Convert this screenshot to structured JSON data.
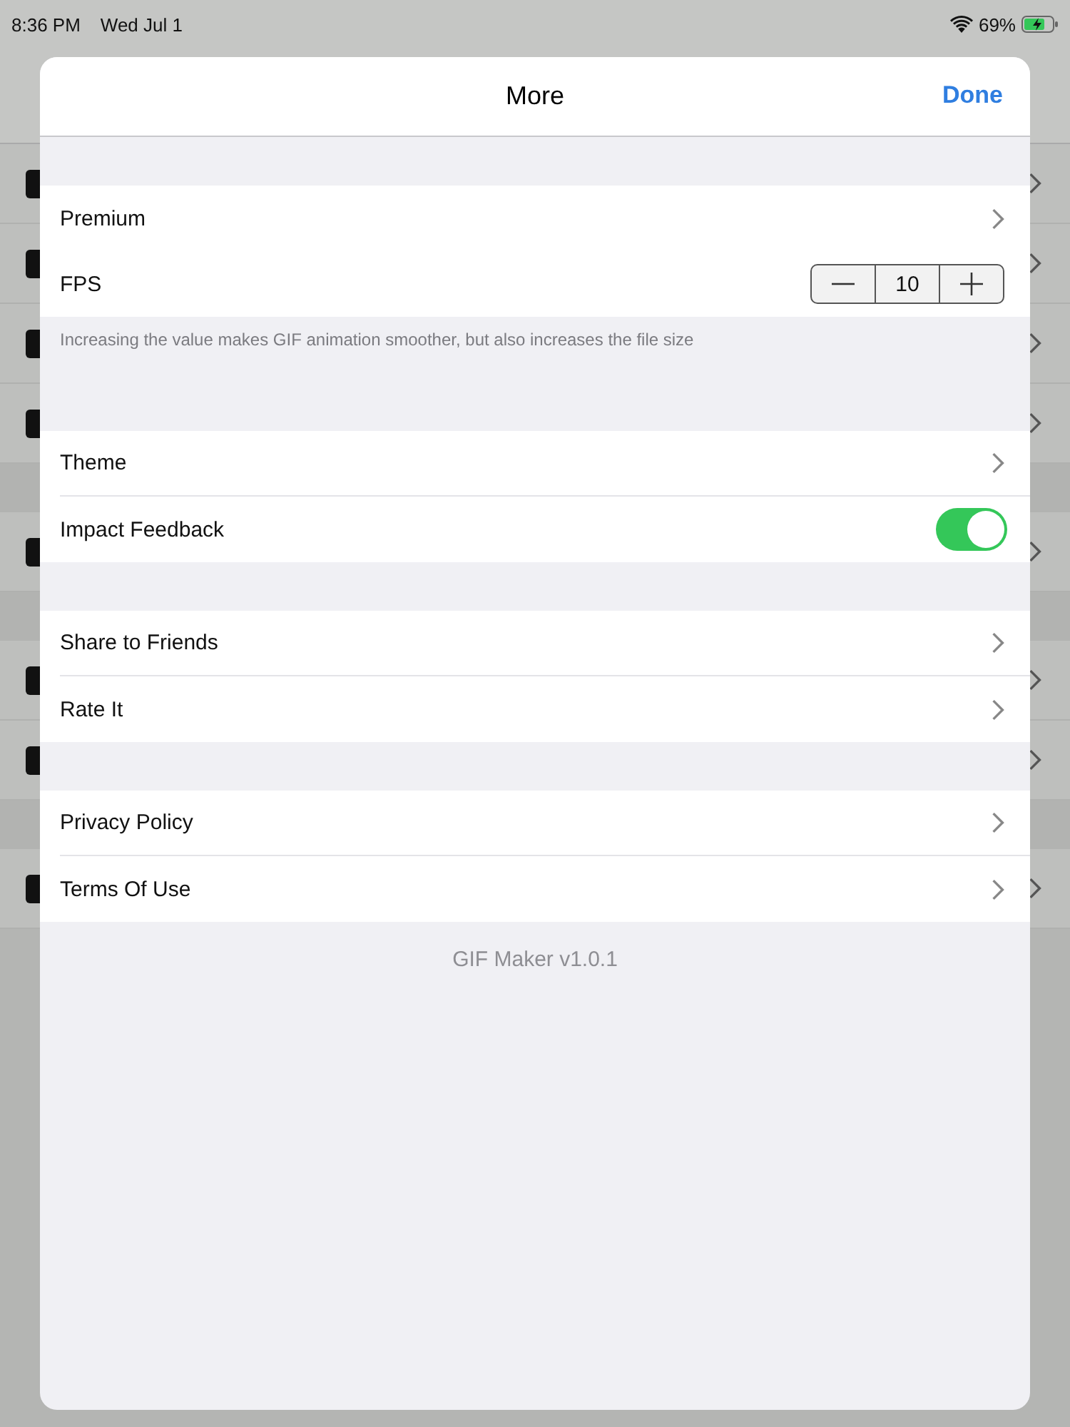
{
  "status_bar": {
    "time": "8:36 PM",
    "date": "Wed Jul 1",
    "battery": "69%"
  },
  "sheet": {
    "title": "More",
    "done": "Done"
  },
  "sections": [
    {
      "rows": [
        {
          "kind": "link",
          "label": "Premium"
        }
      ]
    },
    {
      "rows": [
        {
          "kind": "stepper",
          "label": "FPS",
          "value": "10"
        }
      ],
      "footer": "Increasing the value makes GIF animation smoother, but also increases the file size"
    },
    {
      "rows": [
        {
          "kind": "link",
          "label": "Theme"
        },
        {
          "kind": "toggle",
          "label": "Impact Feedback",
          "on": true
        }
      ]
    },
    {
      "rows": [
        {
          "kind": "link",
          "label": "Share to Friends"
        },
        {
          "kind": "link",
          "label": "Rate It"
        }
      ]
    },
    {
      "rows": [
        {
          "kind": "link",
          "label": "Privacy Policy"
        },
        {
          "kind": "link",
          "label": "Terms Of Use"
        }
      ]
    }
  ],
  "version": "GIF Maker v1.0.1"
}
